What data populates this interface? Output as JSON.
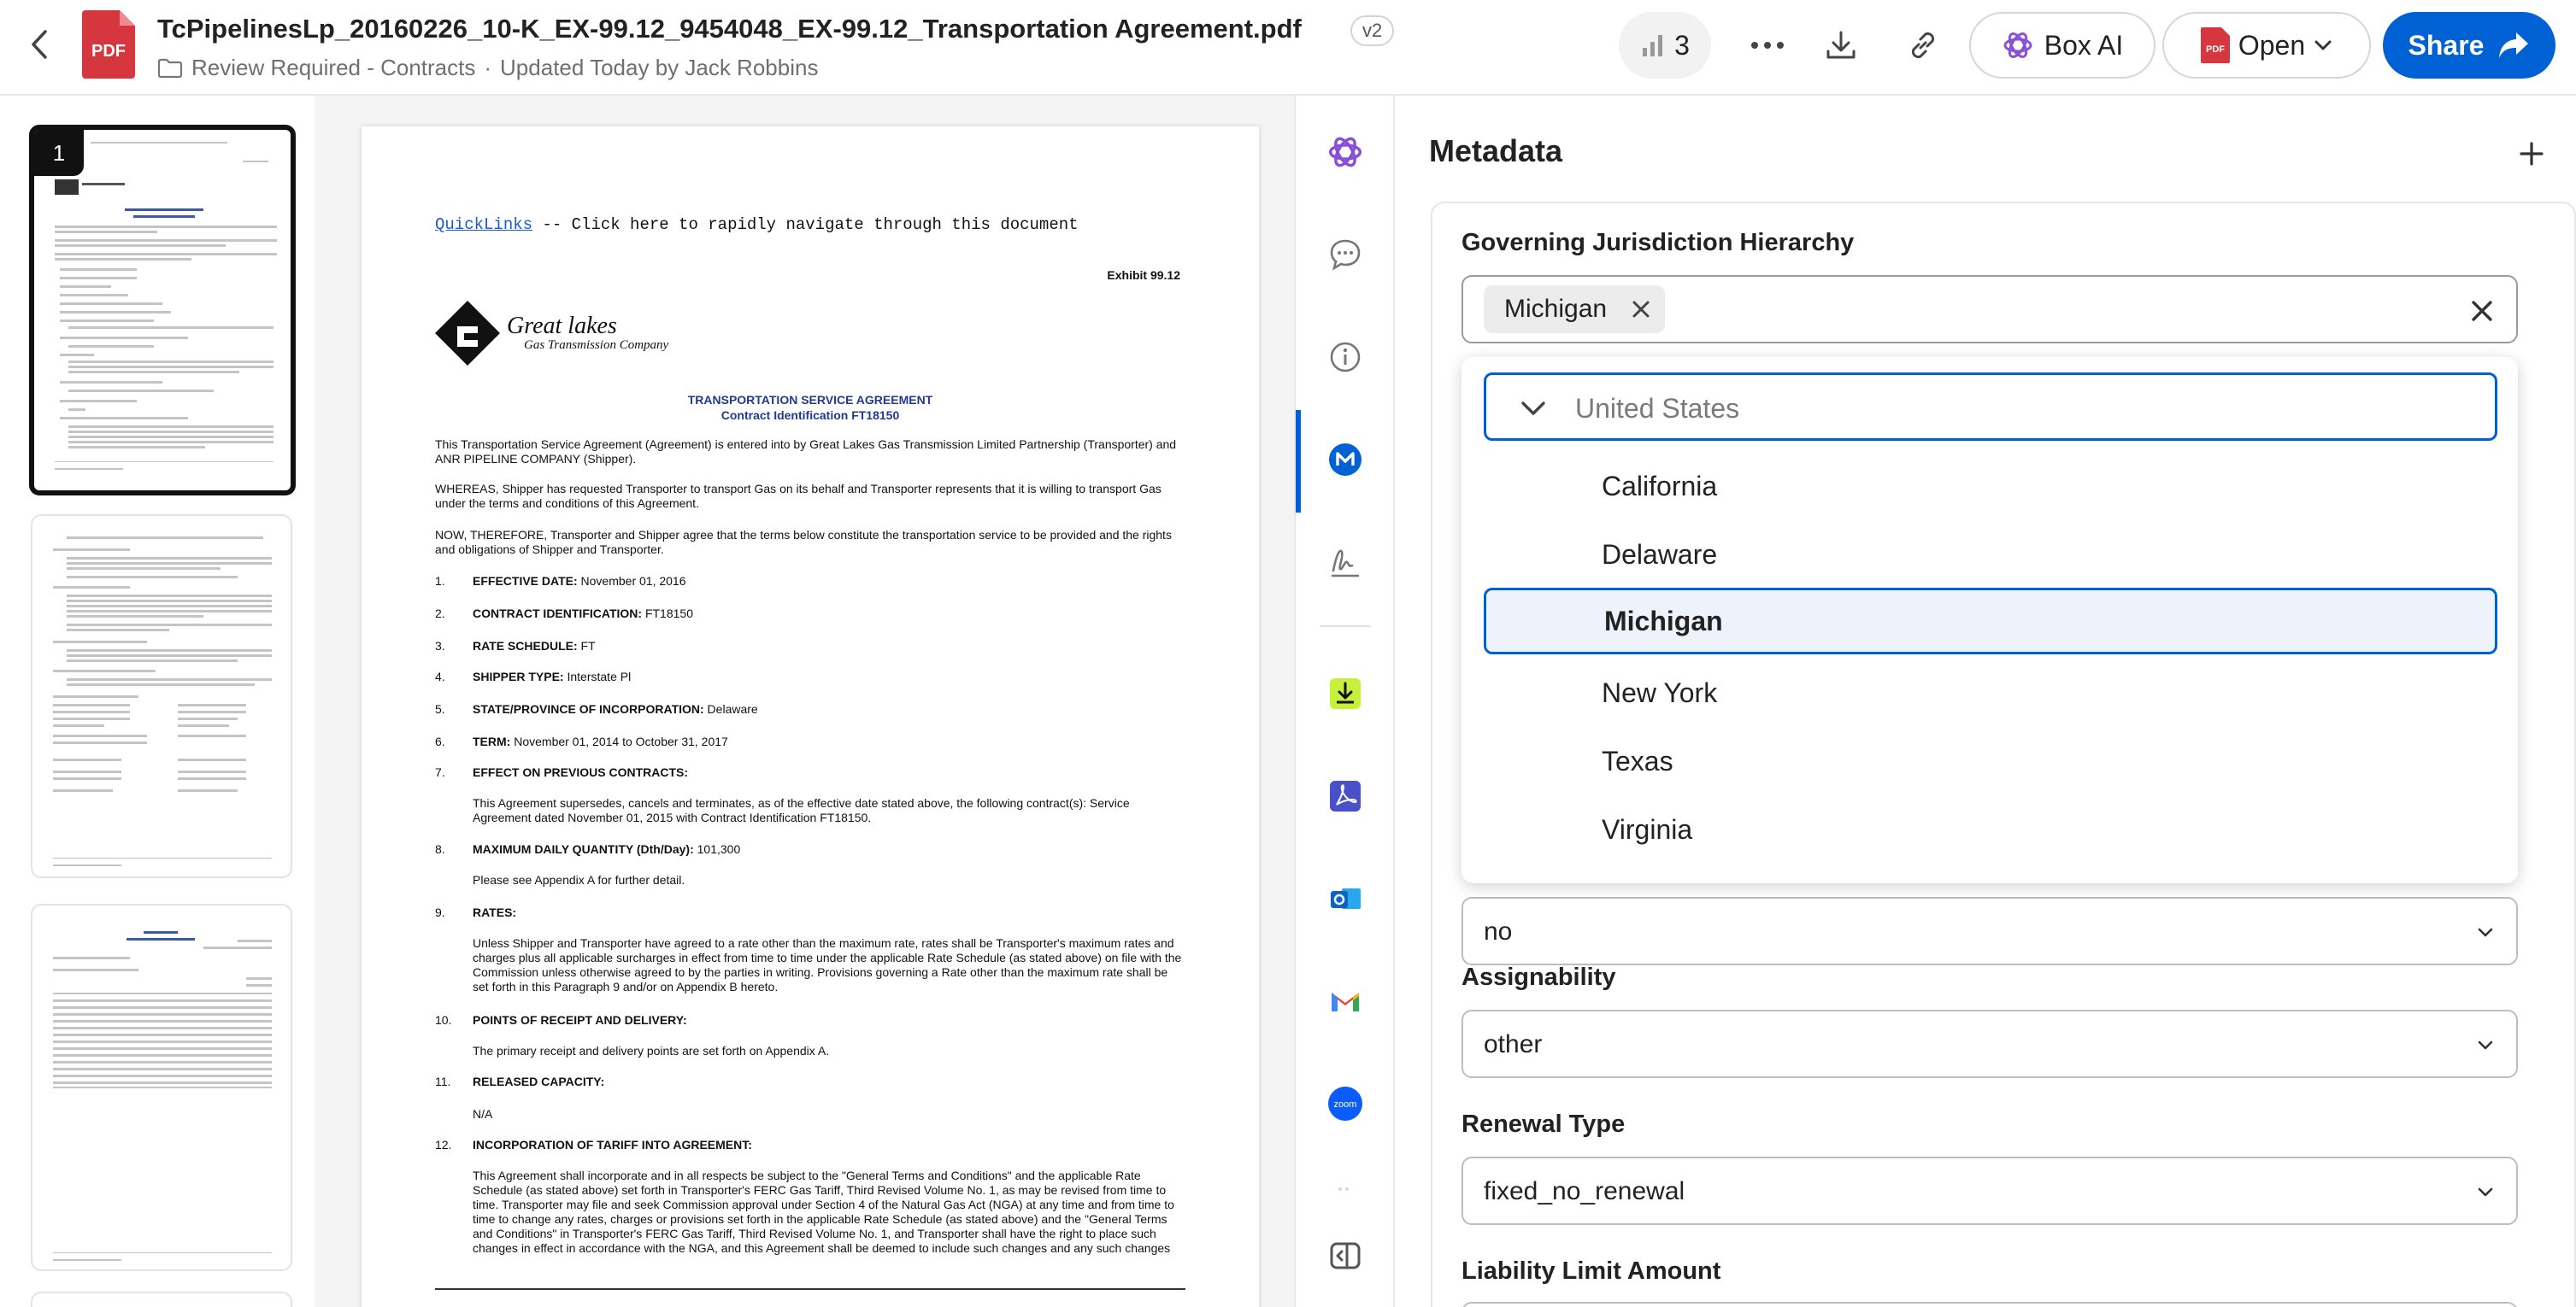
{
  "header": {
    "file_title": "TcPipelinesLp_20160226_10-K_EX-99.12_9454048_EX-99.12_Transportation Agreement.pdf",
    "version": "v2",
    "folder": "Review Required - Contracts",
    "separator": "·",
    "updated": "Updated Today by Jack Robbins",
    "views_count": "3",
    "box_ai_label": "Box AI",
    "open_label": "Open",
    "share_label": "Share",
    "pdf_badge": "PDF"
  },
  "thumbnails": {
    "selected_page": "1"
  },
  "document": {
    "quicklinks_link": "QuickLinks",
    "quicklinks_rest": " -- Click here to rapidly navigate through this document",
    "exhibit": "Exhibit 99.12",
    "logo_name": "Great lakes",
    "logo_sub": "Gas Transmission Company",
    "agreement_title": "TRANSPORTATION SERVICE AGREEMENT",
    "contract_id_line": "Contract Identification FT18150",
    "intro": "This Transportation Service Agreement (Agreement) is entered into by Great Lakes Gas Transmission Limited Partnership (Transporter) and ANR PIPELINE COMPANY (Shipper).",
    "whereas": "WHEREAS, Shipper has requested Transporter to transport Gas on its behalf and Transporter represents that it is willing to transport Gas under the terms and conditions of this Agreement.",
    "now": "NOW, THEREFORE, Transporter and Shipper agree that the terms below constitute the transportation service to be provided and the rights and obligations of Shipper and Transporter.",
    "items": [
      {
        "n": "1.",
        "label": "EFFECTIVE DATE:",
        "value": " November 01, 2016"
      },
      {
        "n": "2.",
        "label": "CONTRACT IDENTIFICATION:",
        "value": " FT18150"
      },
      {
        "n": "3.",
        "label": "RATE SCHEDULE:",
        "value": " FT"
      },
      {
        "n": "4.",
        "label": "SHIPPER TYPE:",
        "value": " Interstate Pl"
      },
      {
        "n": "5.",
        "label": "STATE/PROVINCE OF INCORPORATION:",
        "value": " Delaware"
      },
      {
        "n": "6.",
        "label": "TERM:",
        "value": " November 01, 2014 to October 31, 2017"
      },
      {
        "n": "7.",
        "label": "EFFECT ON PREVIOUS CONTRACTS:",
        "value": ""
      },
      {
        "n": "8.",
        "label": "MAXIMUM DAILY QUANTITY (Dth/Day):",
        "value": " 101,300"
      },
      {
        "n": "9.",
        "label": "RATES:",
        "value": ""
      },
      {
        "n": "10.",
        "label": "POINTS OF RECEIPT AND DELIVERY:",
        "value": ""
      },
      {
        "n": "11.",
        "label": "RELEASED CAPACITY:",
        "value": ""
      },
      {
        "n": "12.",
        "label": "INCORPORATION OF TARIFF INTO AGREEMENT:",
        "value": ""
      }
    ],
    "item7_text": "This Agreement supersedes, cancels and terminates, as of the effective date stated above, the following contract(s): Service Agreement dated November 01, 2015 with Contract Identification FT18150.",
    "item8_text": "Please see Appendix A for further detail.",
    "item9_text": "Unless Shipper and Transporter have agreed to a rate other than the maximum rate, rates shall be Transporter's maximum rates and charges plus all applicable surcharges in effect from time to time under the applicable Rate Schedule (as stated above) on file with the Commission unless otherwise agreed to by the parties in writing. Provisions governing a Rate other than the maximum rate shall be set forth in this Paragraph 9 and/or on Appendix B hereto.",
    "item10_text": "The primary receipt and delivery points are set forth on Appendix A.",
    "item11_text": "N/A",
    "item12_text": "This Agreement shall incorporate and in all respects be subject to the \"General Terms and Conditions\" and the applicable Rate Schedule (as stated above) set forth in Transporter's FERC Gas Tariff, Third Revised Volume No. 1, as may be revised from time to time. Transporter may file and seek Commission approval under Section 4 of the Natural Gas Act (NGA) at any time and from time to time to change any rates, charges or provisions set forth in the applicable Rate Schedule (as stated above) and the \"General Terms and Conditions\" in Transporter's FERC Gas Tariff, Third Revised Volume No. 1, and Transporter shall have the right to place such changes in effect in accordance with the NGA, and this Agreement shall be deemed to include such changes and any such changes"
  },
  "rail": {
    "icons": [
      "box-ai-icon",
      "comment-icon",
      "info-icon",
      "metadata-icon",
      "signature-icon",
      "download-app-icon",
      "acrobat-icon",
      "outlook-icon",
      "gmail-icon",
      "zoom-icon",
      "panel-toggle-icon"
    ],
    "zoom_label": "zoom"
  },
  "metadata": {
    "title": "Metadata",
    "jurisdiction_label": "Governing Jurisdiction Hierarchy",
    "selected_chip": "Michigan",
    "dropdown": {
      "search_placeholder": "United States",
      "options": [
        "California",
        "Delaware",
        "Michigan",
        "New York",
        "Texas",
        "Virginia"
      ],
      "selected": "Michigan"
    },
    "hidden_field_value": "no",
    "assignability_label": "Assignability",
    "assignability_value": "other",
    "renewal_label": "Renewal Type",
    "renewal_value": "fixed_no_renewal",
    "liability_label": "Liability Limit Amount"
  },
  "colors": {
    "accent": "#0061d5",
    "pdf_red": "#d6373f",
    "box_ai_purple": "#8a4fd8"
  }
}
